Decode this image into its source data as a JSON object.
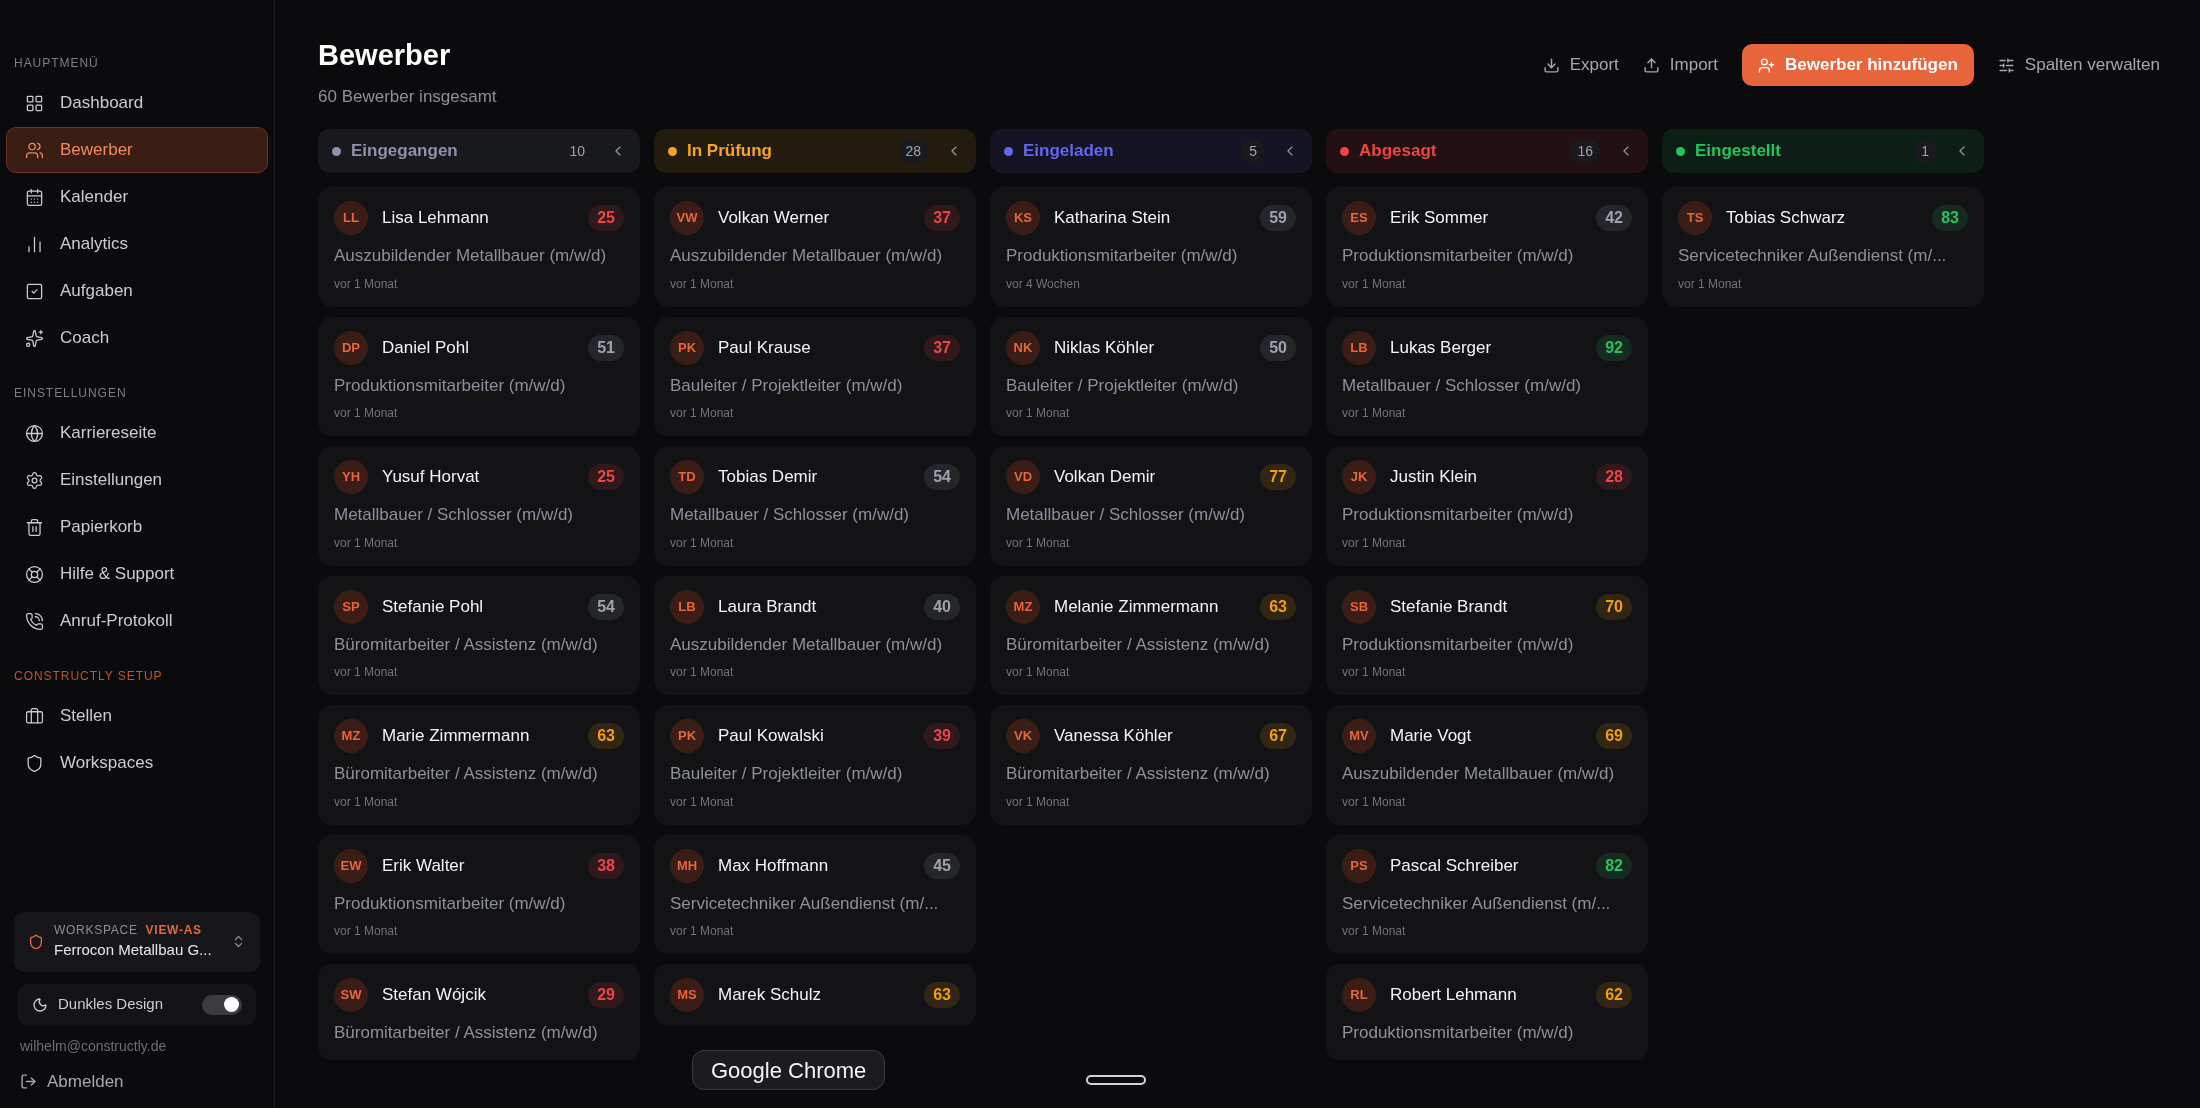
{
  "sidebar": {
    "sections": [
      {
        "title": "HAUPTMENÜ",
        "accent": false,
        "items": [
          {
            "label": "Dashboard",
            "selected": false
          },
          {
            "label": "Bewerber",
            "selected": true
          },
          {
            "label": "Kalender",
            "selected": false
          },
          {
            "label": "Analytics",
            "selected": false
          },
          {
            "label": "Aufgaben",
            "selected": false
          },
          {
            "label": "Coach",
            "selected": false
          }
        ]
      },
      {
        "title": "EINSTELLUNGEN",
        "accent": false,
        "items": [
          {
            "label": "Karriereseite",
            "selected": false
          },
          {
            "label": "Einstellungen",
            "selected": false
          },
          {
            "label": "Papierkorb",
            "selected": false
          },
          {
            "label": "Hilfe & Support",
            "selected": false
          },
          {
            "label": "Anruf-Protokoll",
            "selected": false
          }
        ]
      },
      {
        "title": "CONSTRUCTLY SETUP",
        "accent": true,
        "items": [
          {
            "label": "Stellen",
            "selected": false
          },
          {
            "label": "Workspaces",
            "selected": false
          }
        ]
      }
    ],
    "workspace": {
      "label": "WORKSPACE",
      "badge": "VIEW-AS",
      "name": "Ferrocon Metallbau G..."
    },
    "dark_mode": {
      "label": "Dunkles Design",
      "on": true
    },
    "email": "wilhelm@constructly.de",
    "logout": "Abmelden"
  },
  "header": {
    "title": "Bewerber",
    "subtitle": "60 Bewerber insgesamt",
    "actions": [
      {
        "kind": "export",
        "label": "Export"
      },
      {
        "kind": "import",
        "label": "Import"
      },
      {
        "kind": "primary",
        "label": "Bewerber hinzufügen"
      },
      {
        "kind": "columns",
        "label": "Spalten verwalten"
      }
    ]
  },
  "columns": [
    {
      "title": "Eingegangen",
      "color": "#8b93a7",
      "count": "10",
      "cards": [
        {
          "initials": "LL",
          "name": "Lisa Lehmann",
          "score": "25",
          "color": "#ef4444",
          "role": "Auszubildender Metallbauer (m/w/d)",
          "date": "vor 1 Monat"
        },
        {
          "initials": "DP",
          "name": "Daniel Pohl",
          "score": "51",
          "color": "#9ca3af",
          "role": "Produktionsmitarbeiter (m/w/d)",
          "date": "vor 1 Monat"
        },
        {
          "initials": "YH",
          "name": "Yusuf Horvat",
          "score": "25",
          "color": "#ef4444",
          "role": "Metallbauer / Schlosser (m/w/d)",
          "date": "vor 1 Monat"
        },
        {
          "initials": "SP",
          "name": "Stefanie Pohl",
          "score": "54",
          "color": "#9ca3af",
          "role": "Büromitarbeiter / Assistenz (m/w/d)",
          "date": "vor 1 Monat"
        },
        {
          "initials": "MZ",
          "name": "Marie Zimmermann",
          "score": "63",
          "color": "#f59e0b",
          "role": "Büromitarbeiter / Assistenz (m/w/d)",
          "date": "vor 1 Monat"
        },
        {
          "initials": "EW",
          "name": "Erik Walter",
          "score": "38",
          "color": "#ef4444",
          "role": "Produktionsmitarbeiter (m/w/d)",
          "date": "vor 1 Monat"
        },
        {
          "initials": "SW",
          "name": "Stefan Wójcik",
          "score": "29",
          "color": "#ef4444",
          "role": "Büromitarbeiter / Assistenz (m/w/d)"
        }
      ]
    },
    {
      "title": "In Prüfung",
      "color": "#f5a524",
      "count": "28",
      "cards": [
        {
          "initials": "VW",
          "name": "Volkan Werner",
          "score": "37",
          "color": "#ef4444",
          "role": "Auszubildender Metallbauer (m/w/d)",
          "date": "vor 1 Monat"
        },
        {
          "initials": "PK",
          "name": "Paul Krause",
          "score": "37",
          "color": "#ef4444",
          "role": "Bauleiter / Projektleiter (m/w/d)",
          "date": "vor 1 Monat"
        },
        {
          "initials": "TD",
          "name": "Tobias Demir",
          "score": "54",
          "color": "#9ca3af",
          "role": "Metallbauer / Schlosser (m/w/d)",
          "date": "vor 1 Monat"
        },
        {
          "initials": "LB",
          "name": "Laura Brandt",
          "score": "40",
          "color": "#9ca3af",
          "role": "Auszubildender Metallbauer (m/w/d)",
          "date": "vor 1 Monat"
        },
        {
          "initials": "PK",
          "name": "Paul Kowalski",
          "score": "39",
          "color": "#ef4444",
          "role": "Bauleiter / Projektleiter (m/w/d)",
          "date": "vor 1 Monat"
        },
        {
          "initials": "MH",
          "name": "Max Hoffmann",
          "score": "45",
          "color": "#9ca3af",
          "role": "Servicetechniker Außendienst (m/...",
          "date": "vor 1 Monat"
        },
        {
          "initials": "MS",
          "name": "Marek Schulz",
          "score": "63",
          "color": "#f59e0b"
        }
      ]
    },
    {
      "title": "Eingeladen",
      "color": "#6366f1",
      "count": "5",
      "cards": [
        {
          "initials": "KS",
          "name": "Katharina Stein",
          "score": "59",
          "color": "#9ca3af",
          "role": "Produktionsmitarbeiter (m/w/d)",
          "date": "vor 4 Wochen"
        },
        {
          "initials": "NK",
          "name": "Niklas Köhler",
          "score": "50",
          "color": "#9ca3af",
          "role": "Bauleiter / Projektleiter (m/w/d)",
          "date": "vor 1 Monat"
        },
        {
          "initials": "VD",
          "name": "Volkan Demir",
          "score": "77",
          "color": "#f59e0b",
          "role": "Metallbauer / Schlosser (m/w/d)",
          "date": "vor 1 Monat"
        },
        {
          "initials": "MZ",
          "name": "Melanie Zimmermann",
          "score": "63",
          "color": "#f59e0b",
          "role": "Büromitarbeiter / Assistenz (m/w/d)",
          "date": "vor 1 Monat"
        },
        {
          "initials": "VK",
          "name": "Vanessa Köhler",
          "score": "67",
          "color": "#f59e0b",
          "role": "Büromitarbeiter / Assistenz (m/w/d)",
          "date": "vor 1 Monat"
        }
      ]
    },
    {
      "title": "Abgesagt",
      "color": "#ef4444",
      "count": "16",
      "cards": [
        {
          "initials": "ES",
          "name": "Erik Sommer",
          "score": "42",
          "color": "#9ca3af",
          "role": "Produktionsmitarbeiter (m/w/d)",
          "date": "vor 1 Monat"
        },
        {
          "initials": "LB",
          "name": "Lukas Berger",
          "score": "92",
          "color": "#22c55e",
          "role": "Metallbauer / Schlosser (m/w/d)",
          "date": "vor 1 Monat"
        },
        {
          "initials": "JK",
          "name": "Justin Klein",
          "score": "28",
          "color": "#ef4444",
          "role": "Produktionsmitarbeiter (m/w/d)",
          "date": "vor 1 Monat"
        },
        {
          "initials": "SB",
          "name": "Stefanie Brandt",
          "score": "70",
          "color": "#f59e0b",
          "role": "Produktionsmitarbeiter (m/w/d)",
          "date": "vor 1 Monat"
        },
        {
          "initials": "MV",
          "name": "Marie Vogt",
          "score": "69",
          "color": "#f59e0b",
          "role": "Auszubildender Metallbauer (m/w/d)",
          "date": "vor 1 Monat"
        },
        {
          "initials": "PS",
          "name": "Pascal Schreiber",
          "score": "82",
          "color": "#22c55e",
          "role": "Servicetechniker Außendienst (m/...",
          "date": "vor 1 Monat"
        },
        {
          "initials": "RL",
          "name": "Robert Lehmann",
          "score": "62",
          "color": "#f59e0b",
          "role": "Produktionsmitarbeiter (m/w/d)"
        }
      ]
    },
    {
      "title": "Eingestellt",
      "color": "#22c55e",
      "count": "1",
      "cards": [
        {
          "initials": "TS",
          "name": "Tobias Schwarz",
          "score": "83",
          "color": "#22c55e",
          "role": "Servicetechniker Außendienst (m/...",
          "date": "vor 1 Monat"
        }
      ]
    }
  ],
  "tooltip": "Google Chrome"
}
